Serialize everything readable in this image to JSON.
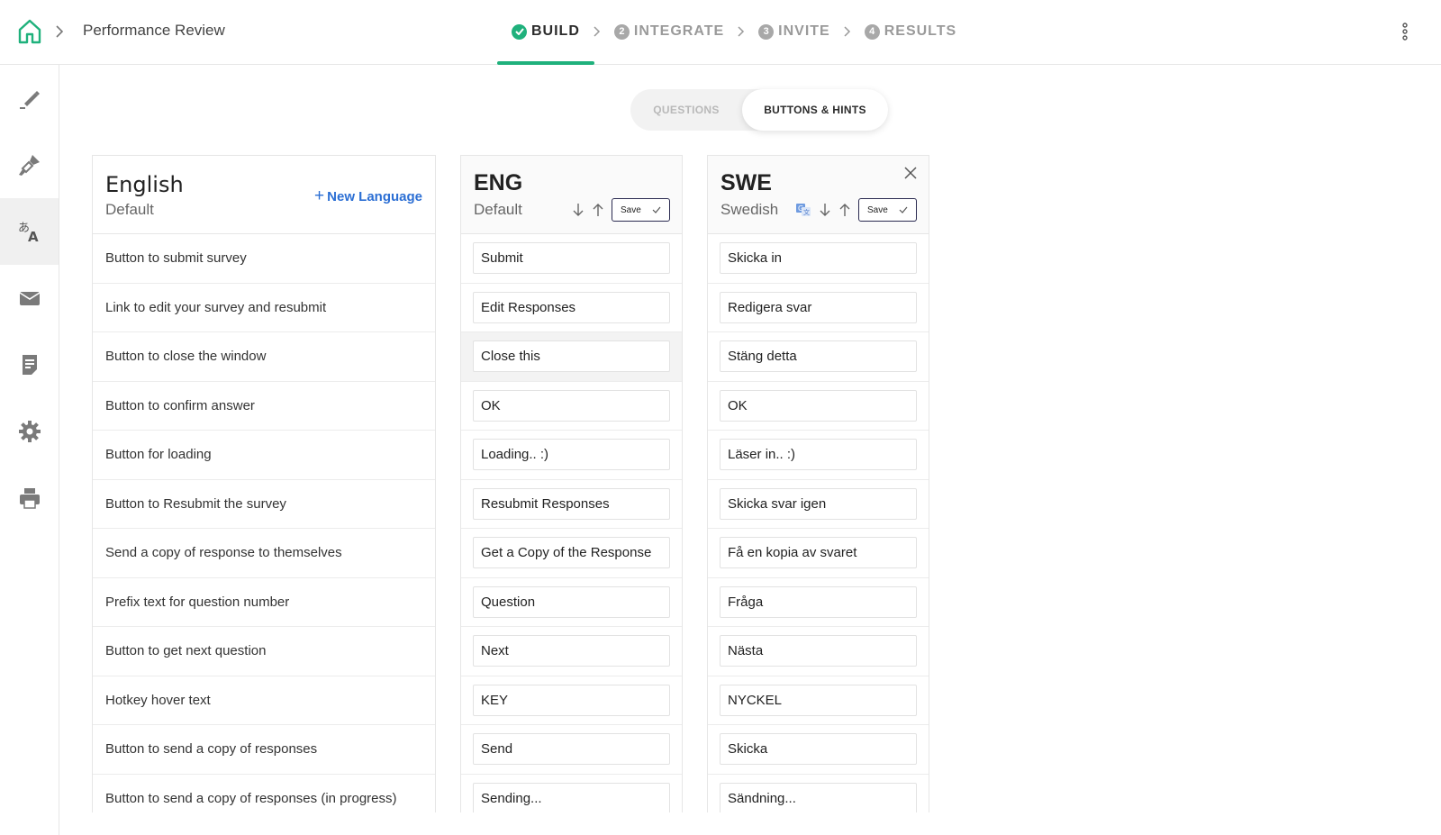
{
  "header": {
    "breadcrumb_title": "Performance Review",
    "steps": [
      {
        "num": "✓",
        "label": "BUILD",
        "active": true
      },
      {
        "num": "2",
        "label": "INTEGRATE",
        "active": false
      },
      {
        "num": "3",
        "label": "INVITE",
        "active": false
      },
      {
        "num": "4",
        "label": "RESULTS",
        "active": false
      }
    ]
  },
  "sidebar": {
    "items": [
      {
        "icon": "pen-icon"
      },
      {
        "icon": "paint-brush-icon"
      },
      {
        "icon": "translate-icon",
        "active": true
      },
      {
        "icon": "mail-icon"
      },
      {
        "icon": "report-icon"
      },
      {
        "icon": "gear-icon"
      },
      {
        "icon": "printer-icon"
      }
    ]
  },
  "tabs": {
    "questions": "QUESTIONS",
    "buttons_hints": "BUTTONS & HINTS"
  },
  "english": {
    "title": "English",
    "subtitle": "Default",
    "new_language": "New Language",
    "rows": [
      "Button to submit survey",
      "Link to edit your survey and resubmit",
      "Button to close the window",
      "Button to confirm answer",
      "Button for loading",
      "Button to Resubmit the survey",
      "Send a copy of response to themselves",
      "Prefix text for question number",
      "Button to get next question",
      "Hotkey hover text",
      "Button to send a copy of responses",
      "Button to send a copy of responses (in progress)"
    ]
  },
  "eng": {
    "title": "ENG",
    "subtitle": "Default",
    "save": "Save",
    "values": [
      "Submit",
      "Edit Responses",
      "Close this",
      "OK",
      "Loading.. :)",
      "Resubmit Responses",
      "Get a Copy of the Response",
      "Question",
      "Next",
      "KEY",
      "Send",
      "Sending..."
    ]
  },
  "swe": {
    "title": "SWE",
    "subtitle": "Swedish",
    "save": "Save",
    "values": [
      "Skicka in",
      "Redigera svar",
      "Stäng detta",
      "OK",
      "Läser in.. :)",
      "Skicka svar igen",
      "Få en kopia av svaret",
      "Fråga",
      "Nästa",
      "NYCKEL",
      "Skicka",
      "Sändning..."
    ]
  },
  "colors": {
    "accent_green": "#1fb17c",
    "link_blue": "#2c6fd4"
  }
}
